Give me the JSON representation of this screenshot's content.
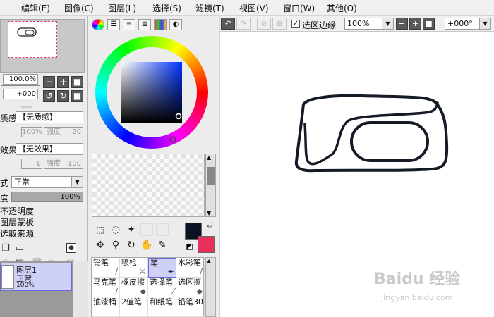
{
  "menubar": {
    "items": [
      "编辑(E)",
      "图像(C)",
      "图层(L)",
      "选择(S)",
      "滤镜(T)",
      "视图(V)",
      "窗口(W)",
      "其他(O)"
    ]
  },
  "navigator": {
    "zoom_value": "100.0%",
    "rotation_value": "+000"
  },
  "texture": {
    "label_fragment": "质感",
    "value": "【无质感】",
    "scale_value": "100%",
    "strength_label": "强度",
    "strength_value": "20"
  },
  "effect": {
    "label_fragment": "效果",
    "value": "【无效果】",
    "width_value": "1",
    "strength_label": "强度",
    "strength_value": "100"
  },
  "blend": {
    "label_fragment": "式",
    "value": "正常",
    "opacity_label_fragment": "度",
    "opacity_value": "100%"
  },
  "layer_options": [
    "不透明度",
    "图层蒙板",
    "选取来源"
  ],
  "layer": {
    "name": "图层1",
    "mode": "正常",
    "opacity": "100%"
  },
  "brushes": [
    {
      "label": "铅笔"
    },
    {
      "label": "喷枪"
    },
    {
      "label": "笔"
    },
    {
      "label": "水彩笔"
    },
    {
      "label": "马克笔"
    },
    {
      "label": "橡皮擦"
    },
    {
      "label": "选择笔"
    },
    {
      "label": "选区擦"
    },
    {
      "label": "油漆桶"
    },
    {
      "label": "2值笔"
    },
    {
      "label": "和纸笔"
    },
    {
      "label": "铅笔30"
    }
  ],
  "colors": {
    "foreground": "#0d1124",
    "background": "#e8305c",
    "selection_accent": "#6a6ad8"
  },
  "toolbar": {
    "selection_edge_label": "选区边缘",
    "zoom_value": "100%",
    "rotation_value": "+000°"
  },
  "watermark": {
    "text": "Baidu 经验",
    "sub": "jingyan.baidu.com"
  }
}
